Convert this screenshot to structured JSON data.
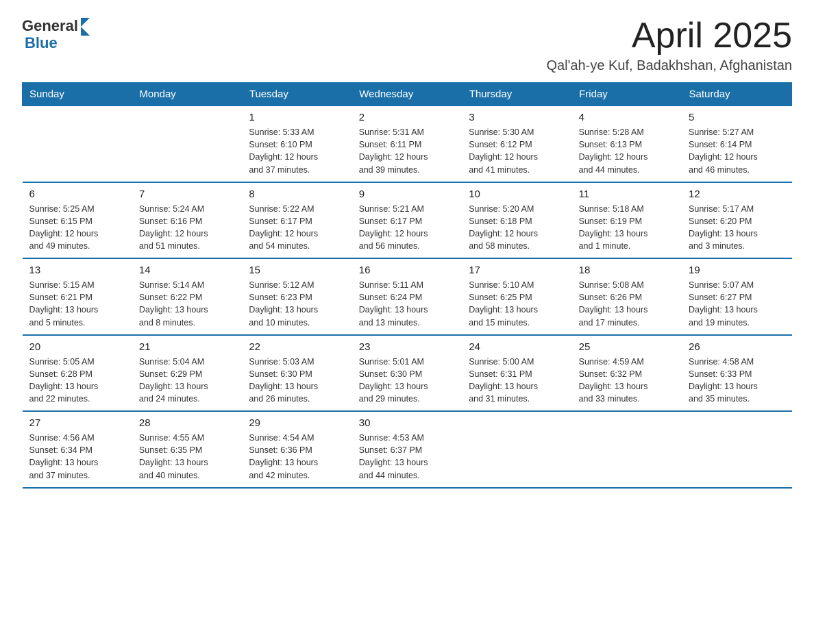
{
  "logo": {
    "general": "General",
    "blue": "Blue"
  },
  "title": "April 2025",
  "subtitle": "Qal'ah-ye Kuf, Badakhshan, Afghanistan",
  "weekdays": [
    "Sunday",
    "Monday",
    "Tuesday",
    "Wednesday",
    "Thursday",
    "Friday",
    "Saturday"
  ],
  "weeks": [
    [
      {
        "day": "",
        "info": ""
      },
      {
        "day": "",
        "info": ""
      },
      {
        "day": "1",
        "info": "Sunrise: 5:33 AM\nSunset: 6:10 PM\nDaylight: 12 hours\nand 37 minutes."
      },
      {
        "day": "2",
        "info": "Sunrise: 5:31 AM\nSunset: 6:11 PM\nDaylight: 12 hours\nand 39 minutes."
      },
      {
        "day": "3",
        "info": "Sunrise: 5:30 AM\nSunset: 6:12 PM\nDaylight: 12 hours\nand 41 minutes."
      },
      {
        "day": "4",
        "info": "Sunrise: 5:28 AM\nSunset: 6:13 PM\nDaylight: 12 hours\nand 44 minutes."
      },
      {
        "day": "5",
        "info": "Sunrise: 5:27 AM\nSunset: 6:14 PM\nDaylight: 12 hours\nand 46 minutes."
      }
    ],
    [
      {
        "day": "6",
        "info": "Sunrise: 5:25 AM\nSunset: 6:15 PM\nDaylight: 12 hours\nand 49 minutes."
      },
      {
        "day": "7",
        "info": "Sunrise: 5:24 AM\nSunset: 6:16 PM\nDaylight: 12 hours\nand 51 minutes."
      },
      {
        "day": "8",
        "info": "Sunrise: 5:22 AM\nSunset: 6:17 PM\nDaylight: 12 hours\nand 54 minutes."
      },
      {
        "day": "9",
        "info": "Sunrise: 5:21 AM\nSunset: 6:17 PM\nDaylight: 12 hours\nand 56 minutes."
      },
      {
        "day": "10",
        "info": "Sunrise: 5:20 AM\nSunset: 6:18 PM\nDaylight: 12 hours\nand 58 minutes."
      },
      {
        "day": "11",
        "info": "Sunrise: 5:18 AM\nSunset: 6:19 PM\nDaylight: 13 hours\nand 1 minute."
      },
      {
        "day": "12",
        "info": "Sunrise: 5:17 AM\nSunset: 6:20 PM\nDaylight: 13 hours\nand 3 minutes."
      }
    ],
    [
      {
        "day": "13",
        "info": "Sunrise: 5:15 AM\nSunset: 6:21 PM\nDaylight: 13 hours\nand 5 minutes."
      },
      {
        "day": "14",
        "info": "Sunrise: 5:14 AM\nSunset: 6:22 PM\nDaylight: 13 hours\nand 8 minutes."
      },
      {
        "day": "15",
        "info": "Sunrise: 5:12 AM\nSunset: 6:23 PM\nDaylight: 13 hours\nand 10 minutes."
      },
      {
        "day": "16",
        "info": "Sunrise: 5:11 AM\nSunset: 6:24 PM\nDaylight: 13 hours\nand 13 minutes."
      },
      {
        "day": "17",
        "info": "Sunrise: 5:10 AM\nSunset: 6:25 PM\nDaylight: 13 hours\nand 15 minutes."
      },
      {
        "day": "18",
        "info": "Sunrise: 5:08 AM\nSunset: 6:26 PM\nDaylight: 13 hours\nand 17 minutes."
      },
      {
        "day": "19",
        "info": "Sunrise: 5:07 AM\nSunset: 6:27 PM\nDaylight: 13 hours\nand 19 minutes."
      }
    ],
    [
      {
        "day": "20",
        "info": "Sunrise: 5:05 AM\nSunset: 6:28 PM\nDaylight: 13 hours\nand 22 minutes."
      },
      {
        "day": "21",
        "info": "Sunrise: 5:04 AM\nSunset: 6:29 PM\nDaylight: 13 hours\nand 24 minutes."
      },
      {
        "day": "22",
        "info": "Sunrise: 5:03 AM\nSunset: 6:30 PM\nDaylight: 13 hours\nand 26 minutes."
      },
      {
        "day": "23",
        "info": "Sunrise: 5:01 AM\nSunset: 6:30 PM\nDaylight: 13 hours\nand 29 minutes."
      },
      {
        "day": "24",
        "info": "Sunrise: 5:00 AM\nSunset: 6:31 PM\nDaylight: 13 hours\nand 31 minutes."
      },
      {
        "day": "25",
        "info": "Sunrise: 4:59 AM\nSunset: 6:32 PM\nDaylight: 13 hours\nand 33 minutes."
      },
      {
        "day": "26",
        "info": "Sunrise: 4:58 AM\nSunset: 6:33 PM\nDaylight: 13 hours\nand 35 minutes."
      }
    ],
    [
      {
        "day": "27",
        "info": "Sunrise: 4:56 AM\nSunset: 6:34 PM\nDaylight: 13 hours\nand 37 minutes."
      },
      {
        "day": "28",
        "info": "Sunrise: 4:55 AM\nSunset: 6:35 PM\nDaylight: 13 hours\nand 40 minutes."
      },
      {
        "day": "29",
        "info": "Sunrise: 4:54 AM\nSunset: 6:36 PM\nDaylight: 13 hours\nand 42 minutes."
      },
      {
        "day": "30",
        "info": "Sunrise: 4:53 AM\nSunset: 6:37 PM\nDaylight: 13 hours\nand 44 minutes."
      },
      {
        "day": "",
        "info": ""
      },
      {
        "day": "",
        "info": ""
      },
      {
        "day": "",
        "info": ""
      }
    ]
  ]
}
